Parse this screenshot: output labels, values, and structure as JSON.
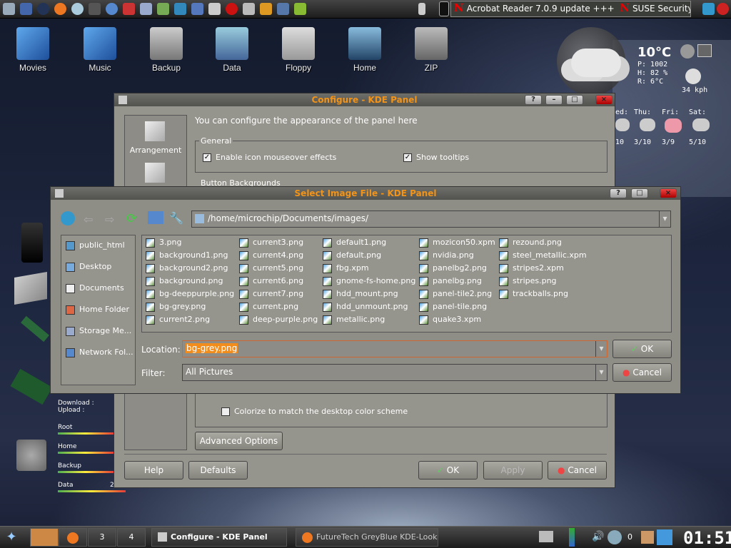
{
  "topbar": {
    "ticker_items": [
      "Acrobat Reader 7.0.9 update +++",
      "SUSE Security Su"
    ],
    "ticker_mark": "N"
  },
  "desktop": {
    "icons": [
      "Movies",
      "Music",
      "Backup",
      "Data",
      "Floppy",
      "Home",
      "ZIP"
    ]
  },
  "weather": {
    "temp": "10°C",
    "pressure": "P: 1002",
    "humidity": "H: 82 %",
    "realfeel": "R: 6°C",
    "wind": "34 kph",
    "days": [
      "ed:",
      "Thu:",
      "Fri:",
      "Sat:"
    ],
    "dates": [
      "10",
      "3/10",
      "3/9",
      "5/10"
    ]
  },
  "sysmon": {
    "labels": [
      "Download :",
      "Upload :",
      "Root",
      "Home",
      "Backup",
      "Data"
    ],
    "data_value": "2"
  },
  "configure": {
    "title": "Configure - KDE Panel",
    "header": "You can configure the appearance of the panel here",
    "sidebar": [
      "Arrangement"
    ],
    "general_legend": "General",
    "chk_mouseover": "Enable icon mouseover effects",
    "chk_tooltips": "Show tooltips",
    "backgrounds_legend": "Button Backgrounds",
    "colorize": "Colorize to match the desktop color scheme",
    "advanced": "Advanced Options",
    "help": "Help",
    "defaults": "Defaults",
    "ok": "OK",
    "apply": "Apply",
    "cancel": "Cancel"
  },
  "select": {
    "title": "Select Image File - KDE Panel",
    "path": "/home/microchip/Documents/images/",
    "places": [
      "public_html",
      "Desktop",
      "Documents",
      "Home Folder",
      "Storage Me...",
      "Network Fol..."
    ],
    "columns": [
      [
        "3.png",
        "background1.png",
        "background2.png",
        "background.png",
        "bg-deeppurple.png",
        "bg-grey.png",
        "current2.png"
      ],
      [
        "current3.png",
        "current4.png",
        "current5.png",
        "current6.png",
        "current7.png",
        "current.png",
        "deep-purple.png"
      ],
      [
        "default1.png",
        "default.png",
        "fbg.xpm",
        "gnome-fs-home.png",
        "hdd_mount.png",
        "hdd_unmount.png",
        "metallic.png"
      ],
      [
        "mozicon50.xpm",
        "nvidia.png",
        "panelbg2.png",
        "panelbg.png",
        "panel-tile2.png",
        "panel-tile.png",
        "quake3.xpm"
      ],
      [
        "rezound.png",
        "steel_metallic.xpm",
        "stripes2.xpm",
        "stripes.png",
        "trackballs.png"
      ]
    ],
    "location_label": "Location:",
    "location_value": "bg-grey.png",
    "filter_label": "Filter:",
    "filter_value": "All Pictures",
    "ok": "OK",
    "cancel": "Cancel"
  },
  "taskbar": {
    "desktops": [
      "3",
      "4"
    ],
    "tasks": [
      "Configure - KDE Panel",
      "FutureTech GreyBlue KDE-Look.or"
    ],
    "tray_num": "0",
    "clock": "01:51"
  }
}
